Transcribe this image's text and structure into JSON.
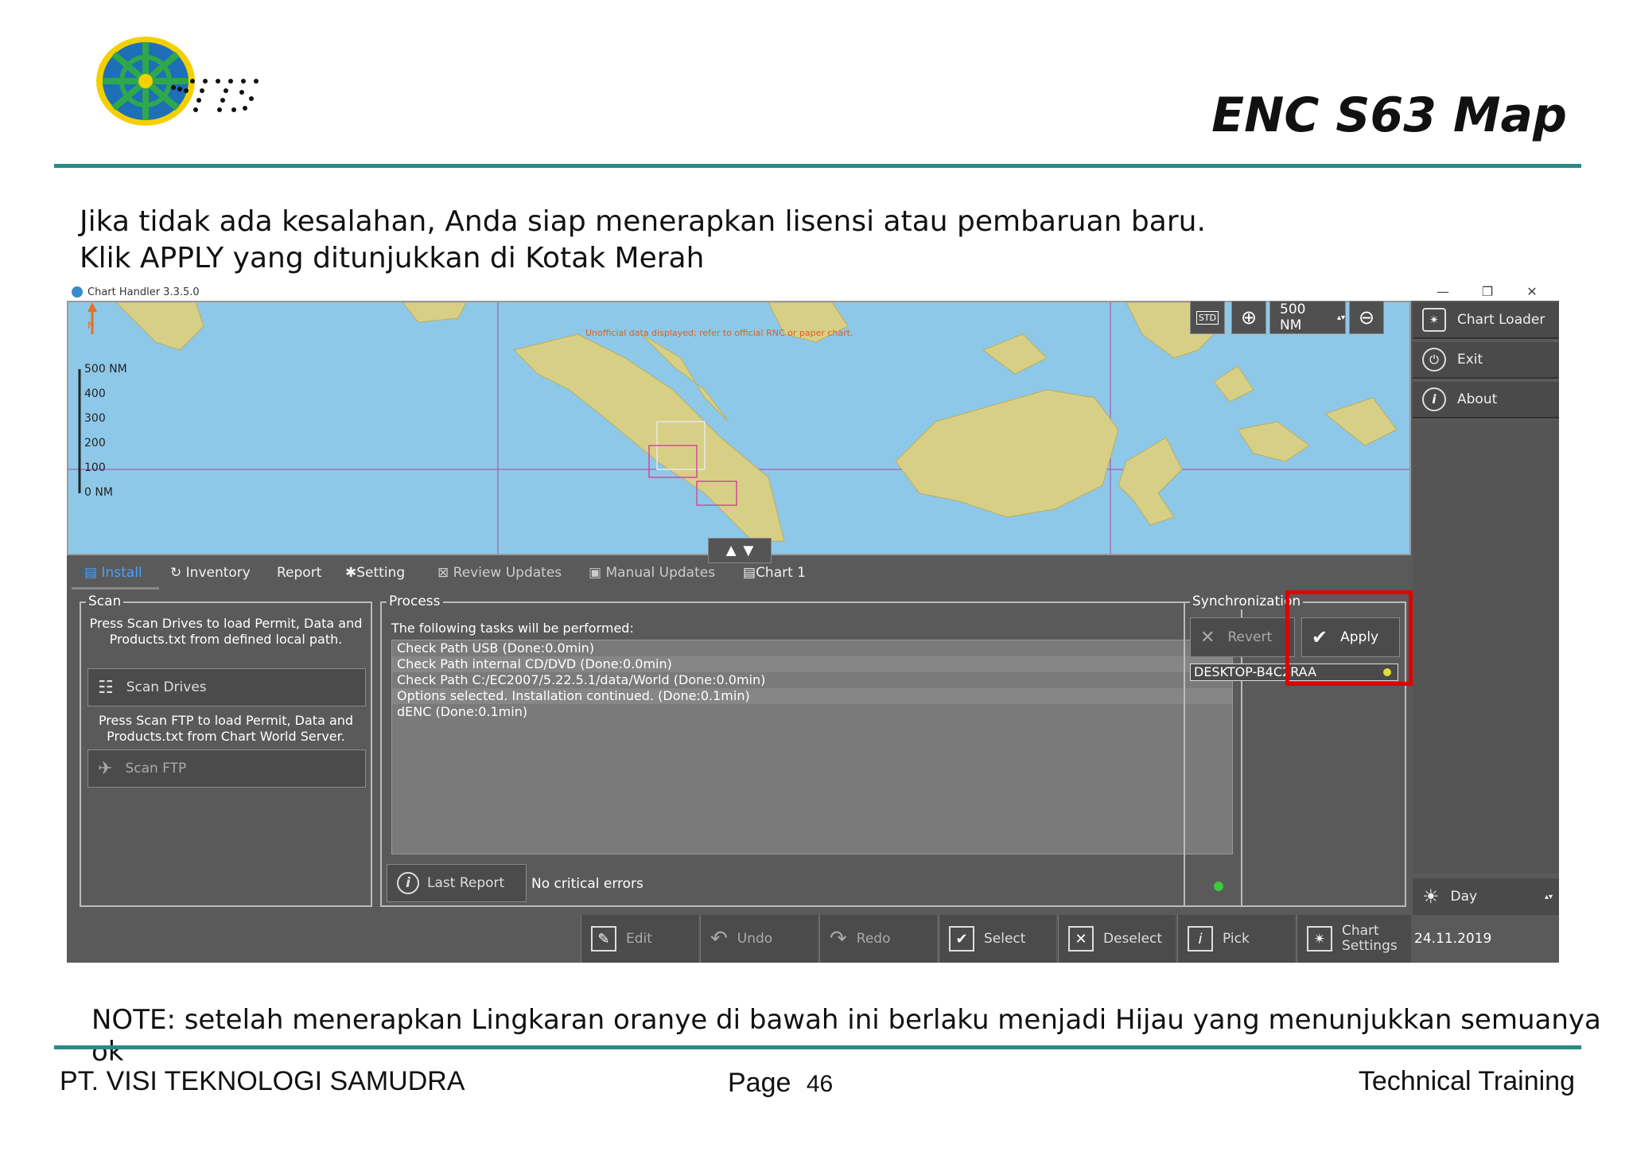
{
  "slide": {
    "title": "ENC S63 Map",
    "instruction_line1": "Jika tidak ada kesalahan, Anda siap menerapkan lisensi atau pembaruan baru.",
    "instruction_line2": "Klik APPLY yang ditunjukkan di Kotak Merah",
    "note": "NOTE: setelah menerapkan Lingkaran oranye di bawah ini berlaku menjadi Hijau yang menunjukkan semuanya ok",
    "footer_left": "PT. VISI TEKNOLOGI SAMUDRA",
    "footer_page_label": "Page",
    "footer_page_number": "46",
    "footer_right": "Technical Training",
    "colors": {
      "rule": "#2a8a86",
      "highlight_box": "#e00000"
    }
  },
  "window": {
    "title": "Chart Handler 3.3.5.0",
    "controls": {
      "minimize": "—",
      "restore": "❐",
      "close": "✕"
    }
  },
  "map": {
    "warning": "Unofficial data displayed; refer to official RNC or paper chart.",
    "north_label": "N",
    "scale_labels": [
      "500 NM",
      "400",
      "300",
      "200",
      "100",
      "0 NM"
    ],
    "zoom_value": "500 NM",
    "std_label": "STD"
  },
  "right_menu": {
    "items": [
      {
        "label": "Chart Loader",
        "icon": "chart-loader-icon"
      },
      {
        "label": "Exit",
        "icon": "power-icon"
      },
      {
        "label": "About",
        "icon": "info-icon"
      }
    ],
    "day_mode": "Day"
  },
  "tabs": [
    {
      "label": "Install",
      "icon": "install-icon",
      "active": true
    },
    {
      "label": "Inventory",
      "icon": "inventory-icon"
    },
    {
      "label": "Report"
    },
    {
      "label": "Setting",
      "icon": "setting-icon"
    },
    {
      "label": "Review Updates",
      "icon": "review-icon"
    },
    {
      "label": "Manual Updates",
      "icon": "manual-icon"
    },
    {
      "label": "Chart 1",
      "icon": "chart-icon"
    }
  ],
  "scan": {
    "title": "Scan",
    "drives_help": "Press Scan Drives to load Permit, Data and Products.txt from defined local path.",
    "drives_button": "Scan Drives",
    "ftp_help": "Press Scan FTP to load Permit, Data and Products.txt from Chart World Server.",
    "ftp_button": "Scan FTP"
  },
  "process": {
    "title": "Process",
    "intro": "The following tasks will be performed:",
    "tasks": [
      "Check Path USB (Done:0.0min)",
      "Check Path internal CD/DVD (Done:0.0min)",
      "Check Path C:/EC2007/5.22.5.1/data/World (Done:0.0min)",
      "Options selected. Installation continued. (Done:0.1min)",
      "dENC (Done:0.1min)"
    ],
    "last_report_button": "Last Report",
    "status": "No critical errors"
  },
  "sync": {
    "title": "Synchronization",
    "revert_button": "Revert",
    "apply_button": "Apply",
    "device": "DESKTOP-B4C2RAA"
  },
  "bottom_toolbar": {
    "buttons": [
      {
        "label": "Edit",
        "icon": "edit-icon"
      },
      {
        "label": "Undo",
        "icon": "undo-icon"
      },
      {
        "label": "Redo",
        "icon": "redo-icon"
      },
      {
        "label": "Select",
        "icon": "select-icon"
      },
      {
        "label": "Deselect",
        "icon": "deselect-icon"
      },
      {
        "label": "Pick",
        "icon": "pick-icon"
      },
      {
        "label": "Chart Settings",
        "icon": "chart-settings-icon"
      }
    ],
    "date": "24.11.2019"
  }
}
